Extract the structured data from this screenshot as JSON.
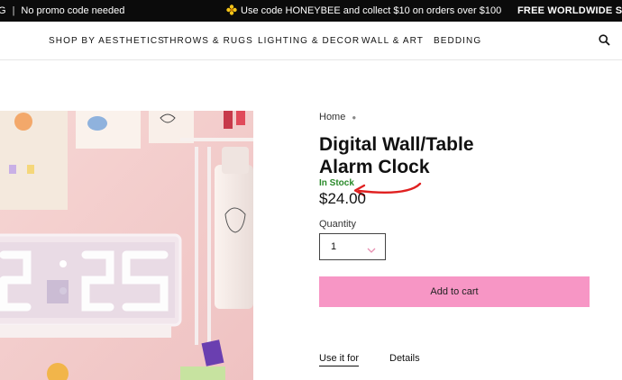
{
  "announcement": {
    "left_prefix": "G",
    "left_text": "No promo code needed",
    "mid_text": "Use code HONEYBEE and collect $10 on orders over $100",
    "right_text": "FREE WORLDWIDE SHIPPING"
  },
  "nav": {
    "items": [
      "SHOP BY AESTHETICS",
      "THROWS & RUGS",
      "LIGHTING & DECOR",
      "WALL & ART",
      "BEDDING"
    ]
  },
  "breadcrumb": {
    "home": "Home"
  },
  "product": {
    "title_line1": "Digital Wall/Table",
    "title_line2": "Alarm Clock",
    "stock": "In Stock",
    "price": "$24.00",
    "quantity_label": "Quantity",
    "quantity_value": "1",
    "add_to_cart": "Add to cart"
  },
  "tabs": [
    "Use it for",
    "Details"
  ],
  "clock_display": "",
  "colors": {
    "accent_pink": "#f796c5",
    "stock_green": "#2a8a2a",
    "arrow_red": "#e02020"
  }
}
